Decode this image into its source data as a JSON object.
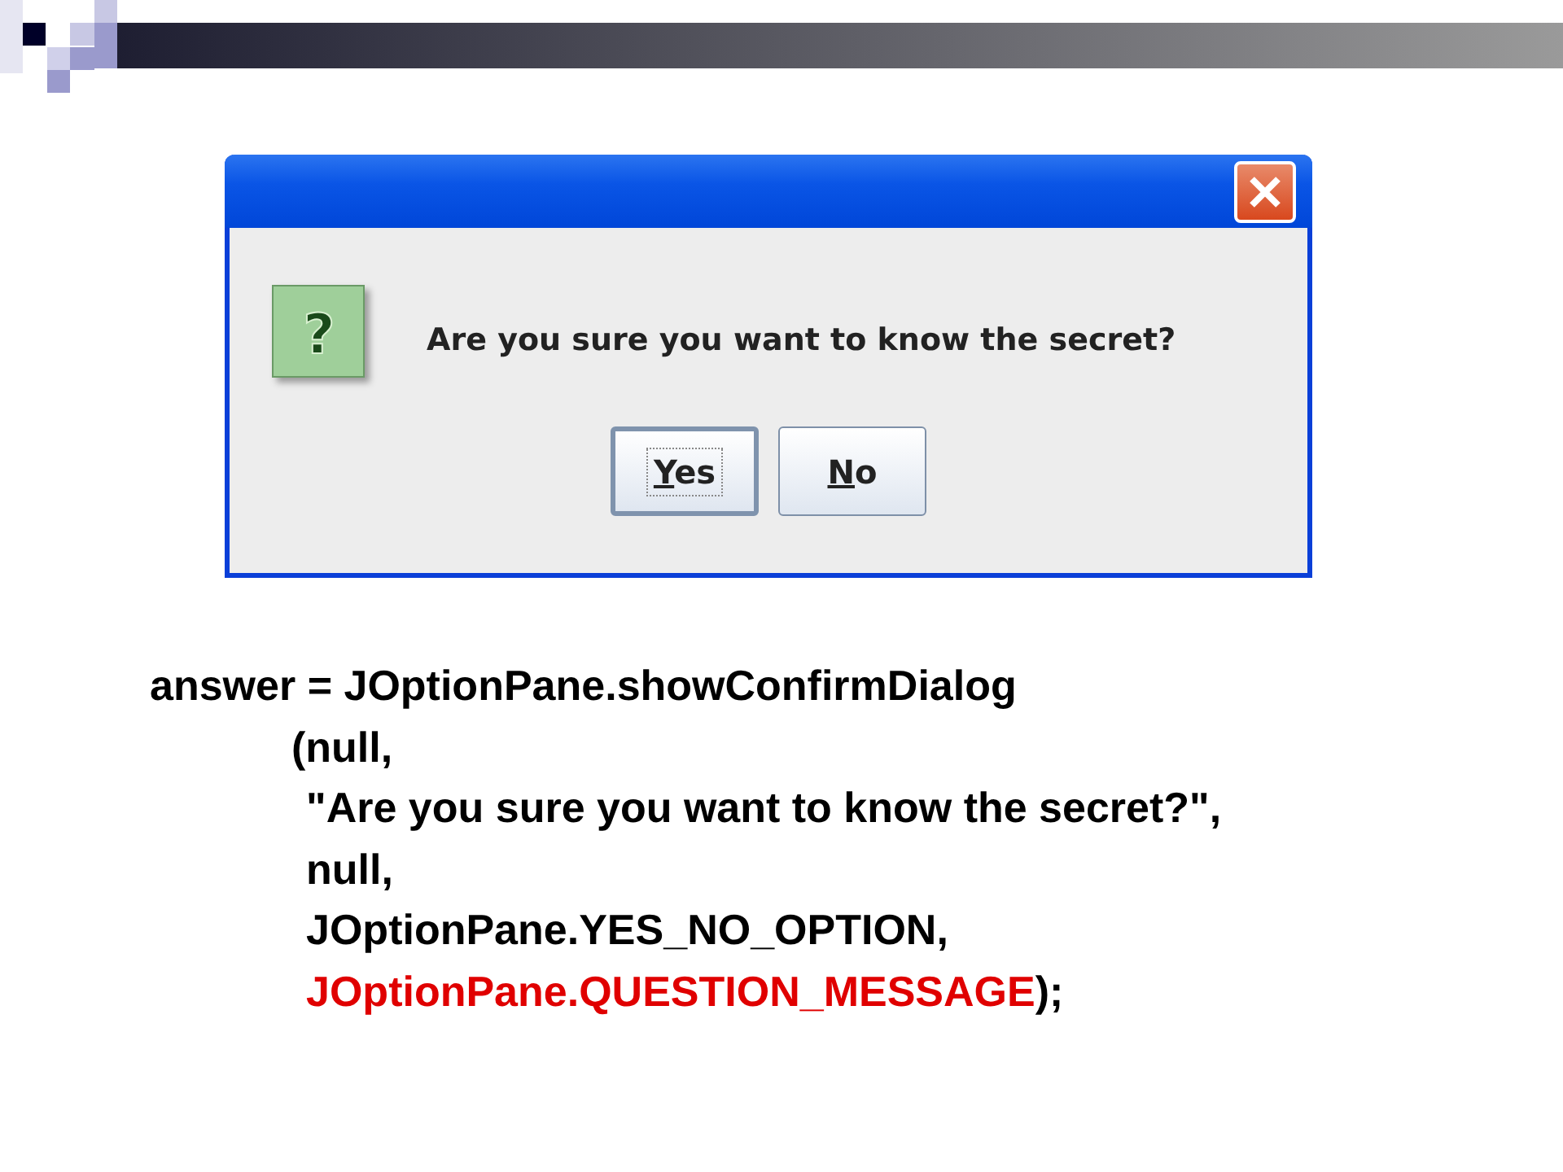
{
  "dialog": {
    "icon": "?",
    "message": "Are you sure you want to know the secret?",
    "buttons": [
      {
        "label": "Yes",
        "focused": true
      },
      {
        "label": "No",
        "focused": false
      }
    ]
  },
  "code": {
    "statement": "answer = JOptionPane.showConfirmDialog",
    "open": "(null,",
    "args": [
      {
        "segments": [
          {
            "text": "\"Are you sure you want to know the secret?\",",
            "highlighted": false
          }
        ]
      },
      {
        "segments": [
          {
            "text": "null,",
            "highlighted": false
          }
        ]
      },
      {
        "segments": [
          {
            "text": "JOptionPane.YES_NO_OPTION,",
            "highlighted": false
          }
        ]
      },
      {
        "segments": [
          {
            "text": "JOptionPane.QUESTION_MESSAGE",
            "highlighted": true
          },
          {
            "text": ");",
            "highlighted": false
          }
        ]
      }
    ]
  }
}
